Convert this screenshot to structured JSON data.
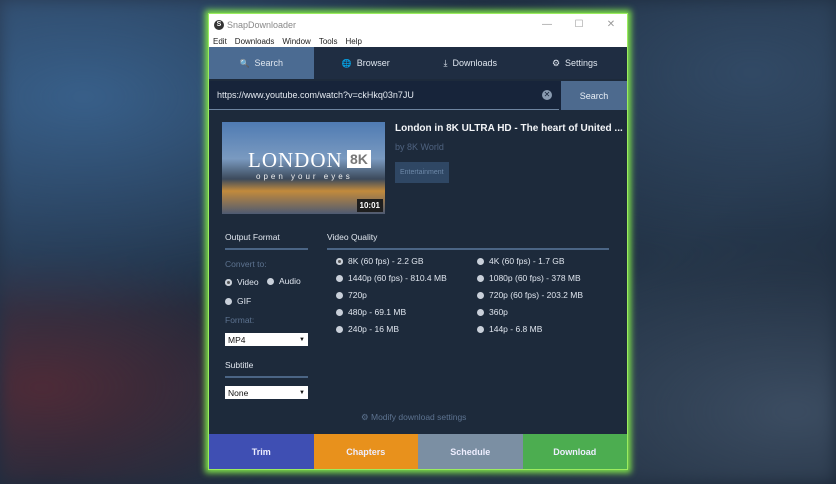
{
  "window": {
    "title": "SnapDownloader",
    "controls": [
      "—",
      "☐",
      "✕"
    ]
  },
  "menu": [
    "Edit",
    "Downloads",
    "Window",
    "Tools",
    "Help"
  ],
  "tabs": [
    {
      "label": "Search",
      "icon": "🔍"
    },
    {
      "label": "Browser",
      "icon": "🌐"
    },
    {
      "label": "Downloads",
      "icon": "⤓"
    },
    {
      "label": "Settings",
      "icon": "⚙"
    }
  ],
  "search": {
    "url": "https://www.youtube.com/watch?v=ckHkq03n7JU",
    "button": "Search"
  },
  "video": {
    "title": "London in 8K ULTRA HD - The heart of United ...",
    "channel": "by 8K World",
    "category": "Entertainment",
    "duration": "10:01",
    "thumb_text": "LONDON",
    "thumb_badge": "8K",
    "thumb_sub": "open your eyes"
  },
  "output": {
    "heading": "Output Format",
    "convert_label": "Convert to:",
    "options": [
      "Video",
      "Audio",
      "GIF"
    ],
    "selected": "Video",
    "format_label": "Format:",
    "format": "MP4",
    "subtitle_heading": "Subtitle",
    "subtitle": "None"
  },
  "quality": {
    "heading": "Video Quality",
    "left": [
      "8K (60 fps) - 2.2 GB",
      "1440p (60 fps) - 810.4 MB",
      "720p",
      "480p - 69.1 MB",
      "240p - 16 MB"
    ],
    "right": [
      "4K (60 fps) - 1.7 GB",
      "1080p (60 fps) - 378 MB",
      "720p (60 fps) - 203.2 MB",
      "360p",
      "144p - 6.8 MB"
    ],
    "selected": "8K (60 fps) - 2.2 GB"
  },
  "modify": "Modify download settings",
  "actions": [
    {
      "label": "Trim",
      "color": "#3f4fb3"
    },
    {
      "label": "Chapters",
      "color": "#e8911c"
    },
    {
      "label": "Schedule",
      "color": "#7b8fa3"
    },
    {
      "label": "Download",
      "color": "#4cad50"
    }
  ]
}
